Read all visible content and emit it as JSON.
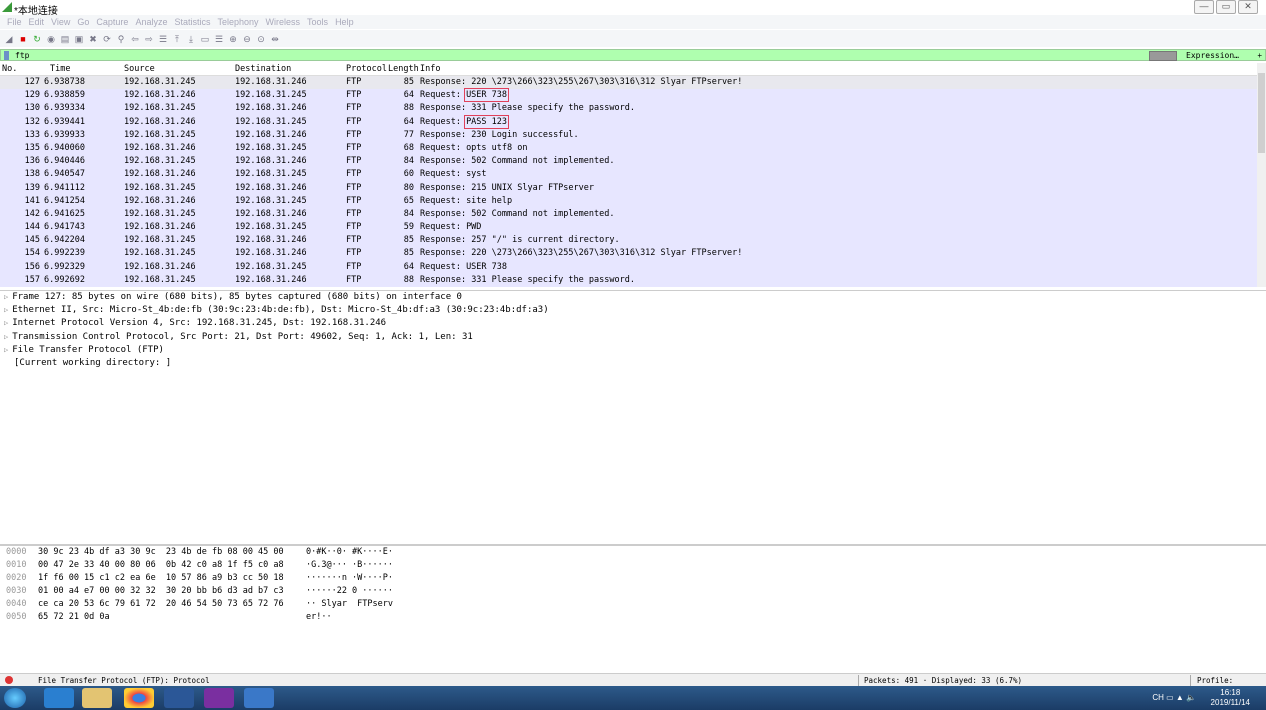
{
  "window": {
    "title": "*本地连接",
    "controls": [
      "—",
      "▭",
      "✕"
    ]
  },
  "menu": [
    "File",
    "Edit",
    "View",
    "Go",
    "Capture",
    "Analyze",
    "Statistics",
    "Telephony",
    "Wireless",
    "Tools",
    "Help"
  ],
  "toolbar_icons": [
    "shark-fin-icon",
    "stop-icon",
    "restart-icon",
    "options-icon",
    "open-icon",
    "save-icon",
    "close-file-icon",
    "reload-icon",
    "find-icon",
    "back-icon",
    "forward-icon",
    "goto-icon",
    "first-icon",
    "last-icon",
    "autoscroll-icon",
    "colorize-icon",
    "zoom-in-icon",
    "zoom-out-icon",
    "zoom-reset-icon",
    "resize-columns-icon"
  ],
  "filter": {
    "value": "ftp",
    "expression_label": "Expression…",
    "plus": "+"
  },
  "columns": [
    "No.",
    "Time",
    "Source",
    "Destination",
    "Protocol",
    "Length",
    "Info"
  ],
  "packets": [
    {
      "no": "127",
      "time": "6.938738",
      "src": "192.168.31.245",
      "dst": "192.168.31.246",
      "proto": "FTP",
      "len": "85",
      "info_prefix": "Response: ",
      "info": "220 \\273\\266\\323\\255\\267\\303\\316\\312 Slyar FTPserver!"
    },
    {
      "no": "129",
      "time": "6.938859",
      "src": "192.168.31.246",
      "dst": "192.168.31.245",
      "proto": "FTP",
      "len": "64",
      "info_prefix": "Request: ",
      "info": "USER 738",
      "highlight": true
    },
    {
      "no": "130",
      "time": "6.939334",
      "src": "192.168.31.245",
      "dst": "192.168.31.246",
      "proto": "FTP",
      "len": "88",
      "info_prefix": "Response: ",
      "info": "331 Please specify the password."
    },
    {
      "no": "132",
      "time": "6.939441",
      "src": "192.168.31.246",
      "dst": "192.168.31.245",
      "proto": "FTP",
      "len": "64",
      "info_prefix": "Request: ",
      "info": "PASS 123",
      "highlight": true
    },
    {
      "no": "133",
      "time": "6.939933",
      "src": "192.168.31.245",
      "dst": "192.168.31.246",
      "proto": "FTP",
      "len": "77",
      "info_prefix": "Response: ",
      "info": "230 Login successful."
    },
    {
      "no": "135",
      "time": "6.940060",
      "src": "192.168.31.246",
      "dst": "192.168.31.245",
      "proto": "FTP",
      "len": "68",
      "info_prefix": "Request: ",
      "info": "opts utf8 on"
    },
    {
      "no": "136",
      "time": "6.940446",
      "src": "192.168.31.245",
      "dst": "192.168.31.246",
      "proto": "FTP",
      "len": "84",
      "info_prefix": "Response: ",
      "info": "502 Command not implemented."
    },
    {
      "no": "138",
      "time": "6.940547",
      "src": "192.168.31.246",
      "dst": "192.168.31.245",
      "proto": "FTP",
      "len": "60",
      "info_prefix": "Request: ",
      "info": "syst"
    },
    {
      "no": "139",
      "time": "6.941112",
      "src": "192.168.31.245",
      "dst": "192.168.31.246",
      "proto": "FTP",
      "len": "80",
      "info_prefix": "Response: ",
      "info": "215 UNIX Slyar FTPserver"
    },
    {
      "no": "141",
      "time": "6.941254",
      "src": "192.168.31.246",
      "dst": "192.168.31.245",
      "proto": "FTP",
      "len": "65",
      "info_prefix": "Request: ",
      "info": "site help"
    },
    {
      "no": "142",
      "time": "6.941625",
      "src": "192.168.31.245",
      "dst": "192.168.31.246",
      "proto": "FTP",
      "len": "84",
      "info_prefix": "Response: ",
      "info": "502 Command not implemented."
    },
    {
      "no": "144",
      "time": "6.941743",
      "src": "192.168.31.246",
      "dst": "192.168.31.245",
      "proto": "FTP",
      "len": "59",
      "info_prefix": "Request: ",
      "info": "PWD"
    },
    {
      "no": "145",
      "time": "6.942204",
      "src": "192.168.31.245",
      "dst": "192.168.31.246",
      "proto": "FTP",
      "len": "85",
      "info_prefix": "Response: ",
      "info": "257 \"/\" is current directory."
    },
    {
      "no": "154",
      "time": "6.992239",
      "src": "192.168.31.245",
      "dst": "192.168.31.246",
      "proto": "FTP",
      "len": "85",
      "info_prefix": "Response: ",
      "info": "220 \\273\\266\\323\\255\\267\\303\\316\\312 Slyar FTPserver!"
    },
    {
      "no": "156",
      "time": "6.992329",
      "src": "192.168.31.246",
      "dst": "192.168.31.245",
      "proto": "FTP",
      "len": "64",
      "info_prefix": "Request: ",
      "info": "USER 738"
    },
    {
      "no": "157",
      "time": "6.992692",
      "src": "192.168.31.245",
      "dst": "192.168.31.246",
      "proto": "FTP",
      "len": "88",
      "info_prefix": "Response: ",
      "info": "331 Please specify the password."
    }
  ],
  "details": [
    {
      "text": "Frame 127: 85 bytes on wire (680 bits), 85 bytes captured (680 bits) on interface 0",
      "expand": true
    },
    {
      "text": "Ethernet II, Src: Micro-St_4b:de:fb (30:9c:23:4b:de:fb), Dst: Micro-St_4b:df:a3 (30:9c:23:4b:df:a3)",
      "expand": true
    },
    {
      "text": "Internet Protocol Version 4, Src: 192.168.31.245, Dst: 192.168.31.246",
      "expand": true
    },
    {
      "text": "Transmission Control Protocol, Src Port: 21, Dst Port: 49602, Seq: 1, Ack: 1, Len: 31",
      "expand": true
    },
    {
      "text": "File Transfer Protocol (FTP)",
      "expand": true
    },
    {
      "text": "[Current working directory: ]",
      "expand": false
    }
  ],
  "bytes": [
    {
      "off": "0000",
      "hex": "30 9c 23 4b df a3 30 9c  23 4b de fb 08 00 45 00",
      "ascii": "0·#K··0· #K····E·"
    },
    {
      "off": "0010",
      "hex": "00 47 2e 33 40 00 80 06  0b 42 c0 a8 1f f5 c0 a8",
      "ascii": "·G.3@··· ·B······"
    },
    {
      "off": "0020",
      "hex": "1f f6 00 15 c1 c2 ea 6e  10 57 86 a9 b3 cc 50 18",
      "ascii": "·······n ·W····P·"
    },
    {
      "off": "0030",
      "hex": "01 00 a4 e7 00 00 32 32  30 20 bb b6 d3 ad b7 c3",
      "ascii": "······22 0 ······"
    },
    {
      "off": "0040",
      "hex": "ce ca 20 53 6c 79 61 72  20 46 54 50 73 65 72 76",
      "ascii": "·· Slyar  FTPserv"
    },
    {
      "off": "0050",
      "hex": "65 72 21 0d 0a",
      "ascii": "er!··"
    }
  ],
  "status": {
    "left": "File Transfer Protocol (FTP): Protocol",
    "packets": "Packets: 491 · Displayed: 33 (6.7%)",
    "profile": "Profile: Default"
  },
  "taskbar": {
    "apps": [
      "start-orb",
      "internet-explorer",
      "file-explorer",
      "chrome",
      "word",
      "hex-editor",
      "wireshark"
    ],
    "lang": "CH",
    "time": "16:18",
    "date": "2019/11/14"
  },
  "colors": {
    "filter_bg": "#afffaf",
    "row_bg": "#e7e6ff",
    "highlight_box": "#e0405a"
  }
}
